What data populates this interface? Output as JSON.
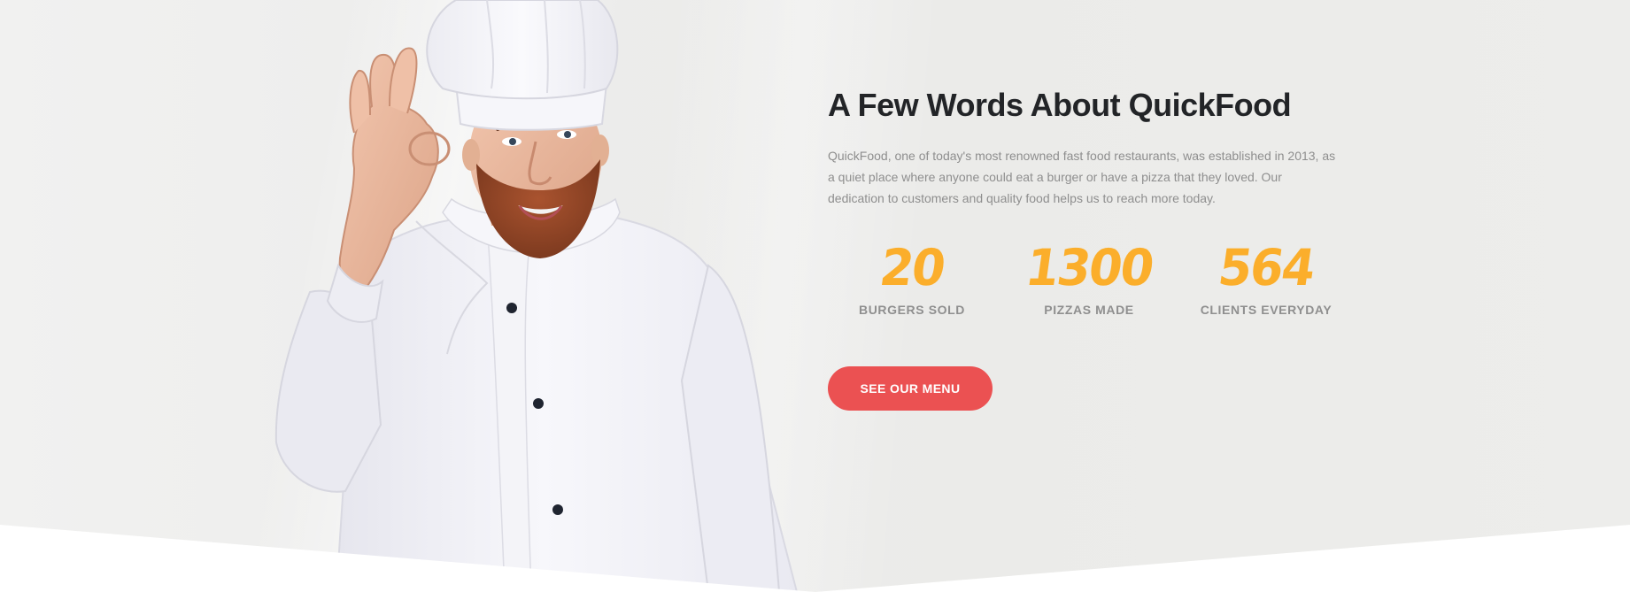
{
  "about": {
    "title": "A Few Words About QuickFood",
    "description": "QuickFood, one of today's most renowned fast food restaurants, was established in 2013, as a quiet place where anyone could eat a burger or have a pizza that they loved. Our dedication to customers and quality food helps us to reach more today."
  },
  "stats": [
    {
      "value": "20",
      "label": "BURGERS SOLD"
    },
    {
      "value": "1300",
      "label": "PIZZAS MADE"
    },
    {
      "value": "564",
      "label": "CLIENTS EVERYDAY"
    }
  ],
  "cta": {
    "label": "SEE OUR MENU"
  },
  "colors": {
    "accent": "#eb5152",
    "stat_number": "#fbae2b",
    "title": "#222427",
    "muted_text": "#8e8e8e",
    "background": "#ececeb"
  },
  "image": {
    "subject": "chef-giving-ok-sign"
  }
}
